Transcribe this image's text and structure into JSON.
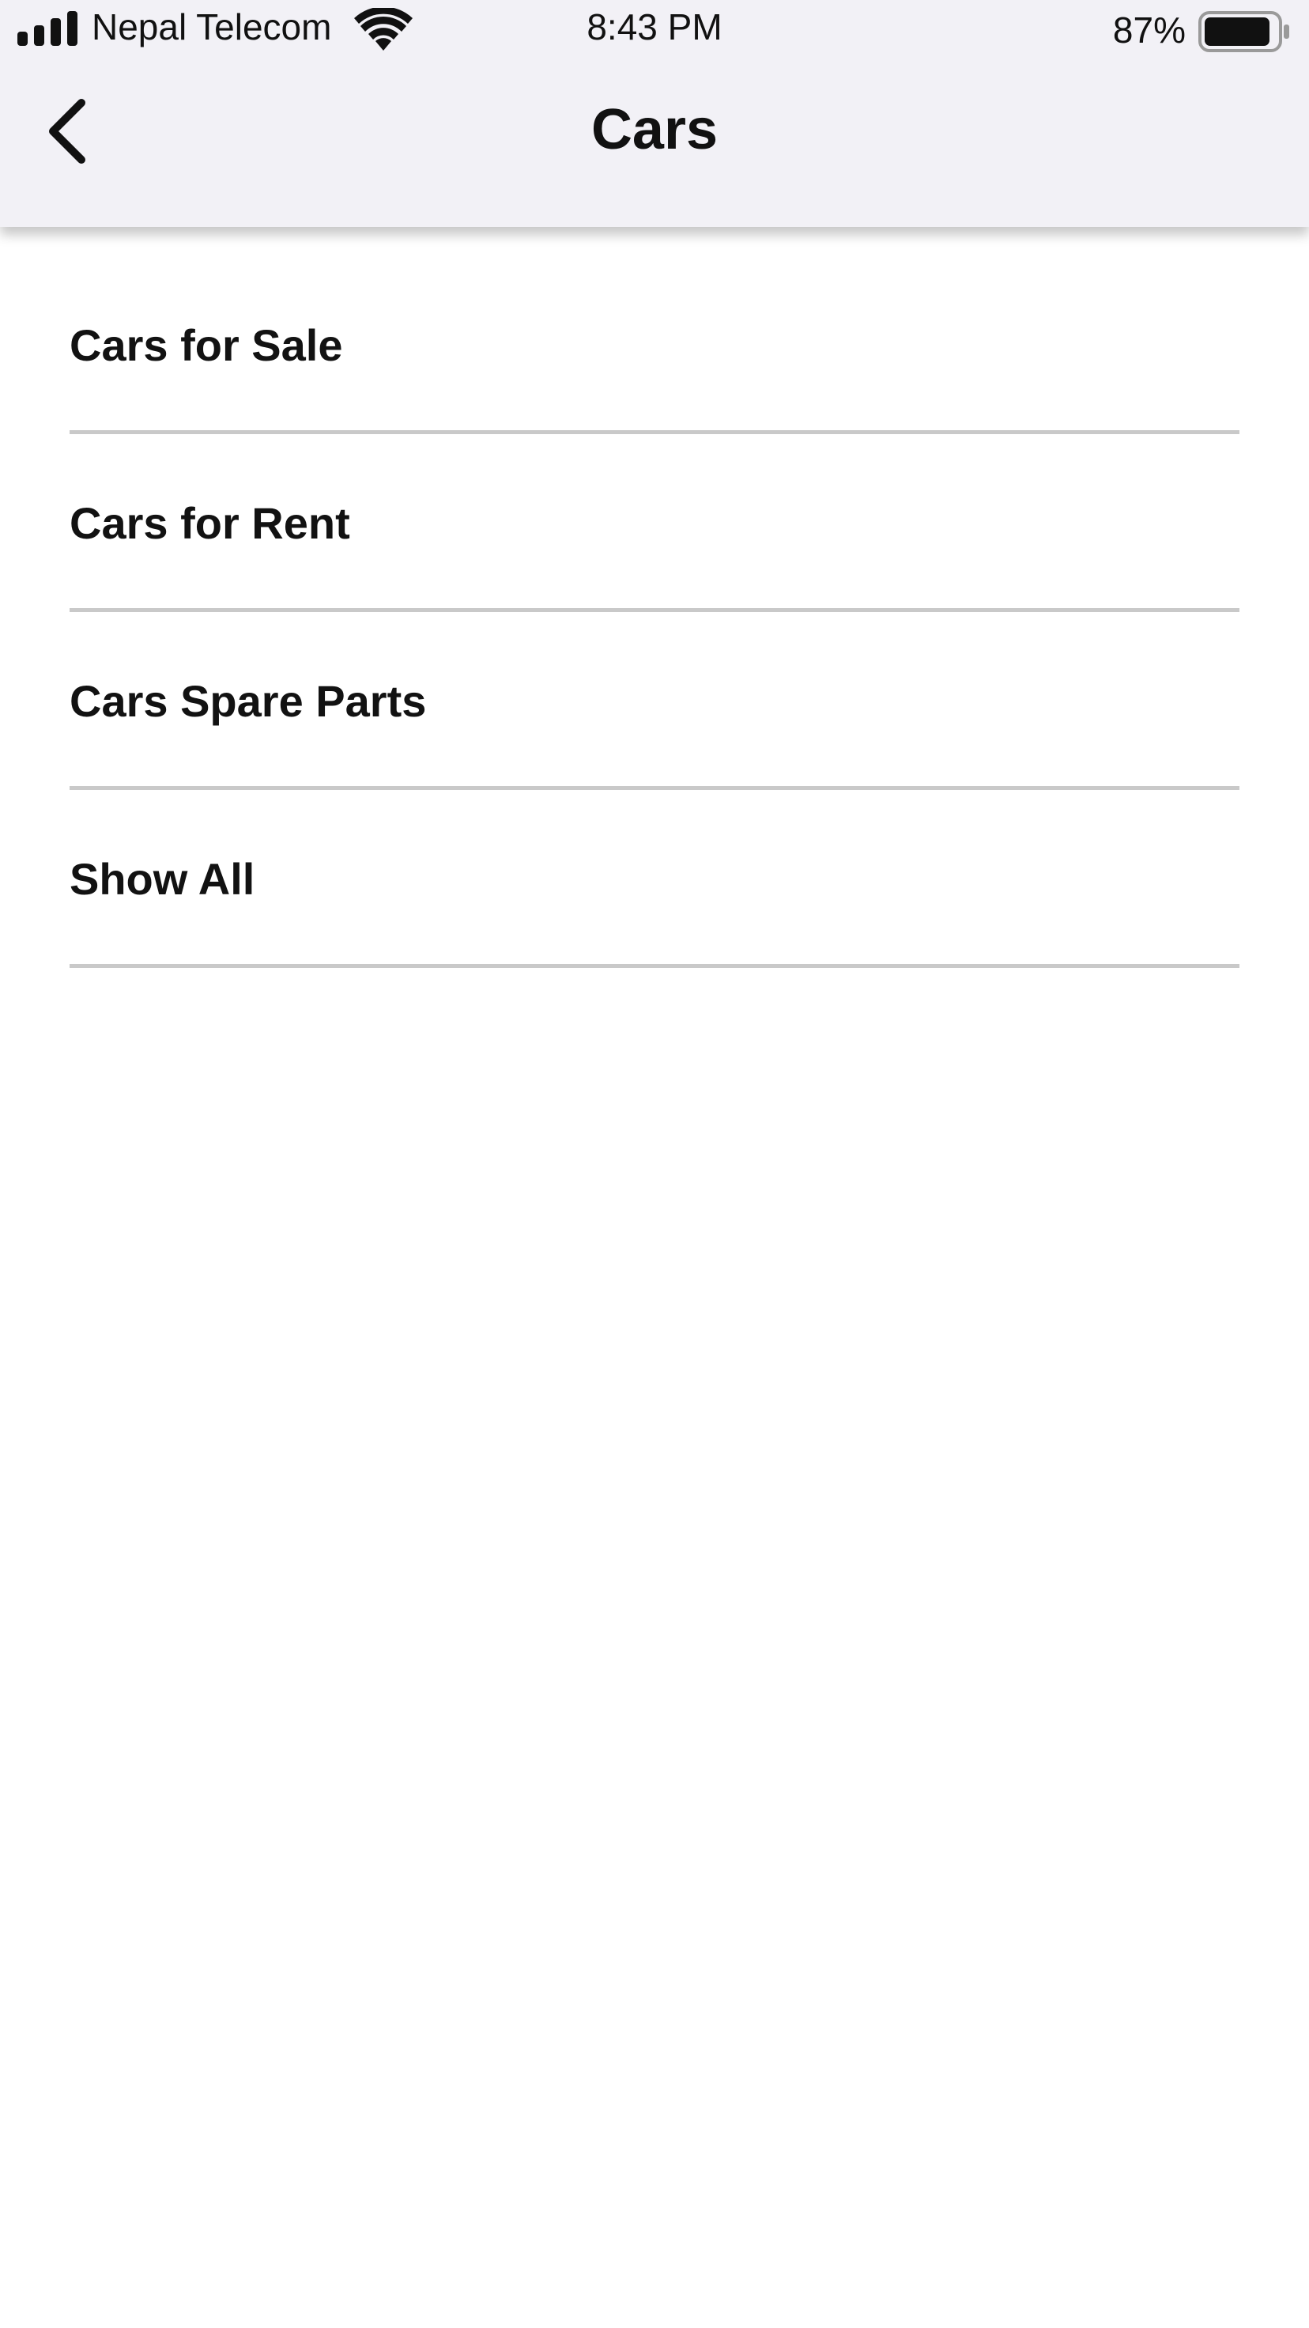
{
  "status_bar": {
    "carrier": "Nepal Telecom",
    "time": "8:43 PM",
    "battery_percent": "87%",
    "icons": [
      "signal-icon",
      "wifi-icon",
      "battery-icon"
    ]
  },
  "nav_bar": {
    "title": "Cars",
    "back_icon": "chevron-left-icon"
  },
  "menu": {
    "items": [
      {
        "label": "Cars for Sale"
      },
      {
        "label": "Cars for Rent"
      },
      {
        "label": "Cars Spare Parts"
      },
      {
        "label": "Show All"
      }
    ]
  },
  "colors": {
    "header_background": "#f2f1f6",
    "page_background": "#ffffff",
    "divider": "#c9c9c9",
    "text": "#111111"
  }
}
